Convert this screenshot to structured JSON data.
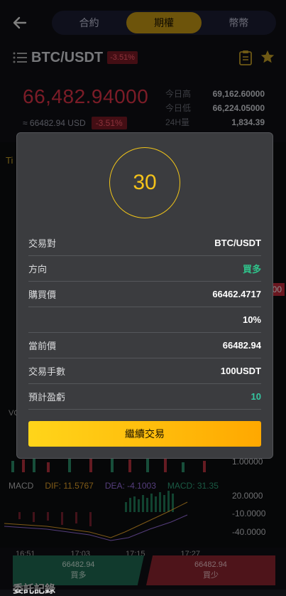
{
  "nav": {
    "tabs": [
      "合約",
      "期權",
      "幣幣"
    ],
    "active_tab": 1
  },
  "pair": {
    "name": "BTC/USDT",
    "change_badge": "-3.51%"
  },
  "ticker": {
    "price": "66,482.94000",
    "usd": "≈ 66482.94 USD",
    "change": "-3.51%",
    "high_label": "今日高",
    "high": "69,162.60000",
    "low_label": "今日低",
    "low": "66,224.05000",
    "vol_label": "24H量",
    "vol": "1,834.39"
  },
  "chart": {
    "time_label": "Ti",
    "right_price": "00",
    "axis_values": [
      "1.00000",
      "20.0000",
      "-10.0000",
      "-40.0000"
    ],
    "vo_label": "VO",
    "macd": {
      "label": "MACD",
      "dif": "DIF: 11.5767",
      "dea": "DEA: -4.1003",
      "macd": "MACD: 31.35"
    },
    "time_ticks": [
      "16:51",
      "17:03",
      "17:15",
      "17:27"
    ]
  },
  "modal": {
    "countdown": "30",
    "rows": [
      {
        "label": "交易對",
        "value": "BTC/USDT",
        "style": ""
      },
      {
        "label": "方向",
        "value": "買多",
        "style": "green"
      },
      {
        "label": "購買價",
        "value": "66462.4717",
        "style": ""
      },
      {
        "label": "",
        "value": "10%",
        "style": ""
      },
      {
        "label": "當前價",
        "value": "66482.94",
        "style": ""
      },
      {
        "label": "交易手數",
        "value": "100USDT",
        "style": ""
      },
      {
        "label": "預計盈虧",
        "value": "10",
        "style": "teal"
      }
    ],
    "continue_label": "繼續交易"
  },
  "bottom": {
    "buy_price": "66482.94",
    "buy_label": "買多",
    "sell_price": "66482.94",
    "sell_label": "買少",
    "section_title": "委託記錄"
  },
  "colors": {
    "accent": "#f3c21a",
    "up": "#2fc28a",
    "down": "#e03448"
  }
}
